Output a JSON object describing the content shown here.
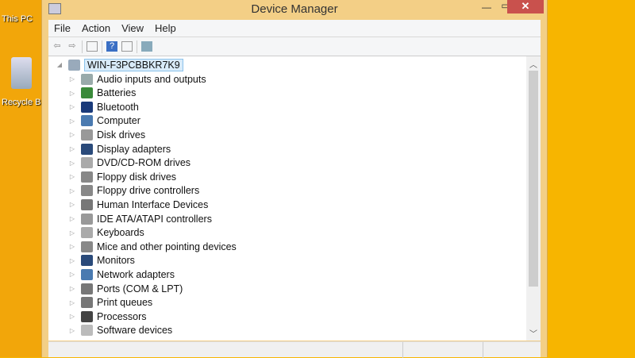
{
  "desktop": {
    "icons": [
      {
        "label": "This PC",
        "icon": "computer-icon"
      },
      {
        "label": "Recycle Bin",
        "icon": "recycle-bin-icon"
      }
    ]
  },
  "window": {
    "title": "Device Manager",
    "close": "✕",
    "minimize": "—",
    "maximize": "▭"
  },
  "menu": [
    "File",
    "Action",
    "View",
    "Help"
  ],
  "toolbar": [
    "back-icon",
    "forward-icon",
    "properties-icon",
    "help-icon",
    "view-icon",
    "scan-icon"
  ],
  "tree": {
    "root": "WIN-F3PCBBKR7K9",
    "items": [
      {
        "label": "Audio inputs and outputs",
        "color": "#9aa"
      },
      {
        "label": "Batteries",
        "color": "#3a8a3a"
      },
      {
        "label": "Bluetooth",
        "color": "#1a3a7a"
      },
      {
        "label": "Computer",
        "color": "#4a7ab0"
      },
      {
        "label": "Disk drives",
        "color": "#999"
      },
      {
        "label": "Display adapters",
        "color": "#2a4a7a"
      },
      {
        "label": "DVD/CD-ROM drives",
        "color": "#aaa"
      },
      {
        "label": "Floppy disk drives",
        "color": "#888"
      },
      {
        "label": "Floppy drive controllers",
        "color": "#888"
      },
      {
        "label": "Human Interface Devices",
        "color": "#777"
      },
      {
        "label": "IDE ATA/ATAPI controllers",
        "color": "#999"
      },
      {
        "label": "Keyboards",
        "color": "#aaa"
      },
      {
        "label": "Mice and other pointing devices",
        "color": "#888"
      },
      {
        "label": "Monitors",
        "color": "#2a4a7a"
      },
      {
        "label": "Network adapters",
        "color": "#4a7ab0"
      },
      {
        "label": "Ports (COM & LPT)",
        "color": "#777"
      },
      {
        "label": "Print queues",
        "color": "#777"
      },
      {
        "label": "Processors",
        "color": "#444"
      },
      {
        "label": "Software devices",
        "color": "#bbb"
      }
    ]
  }
}
